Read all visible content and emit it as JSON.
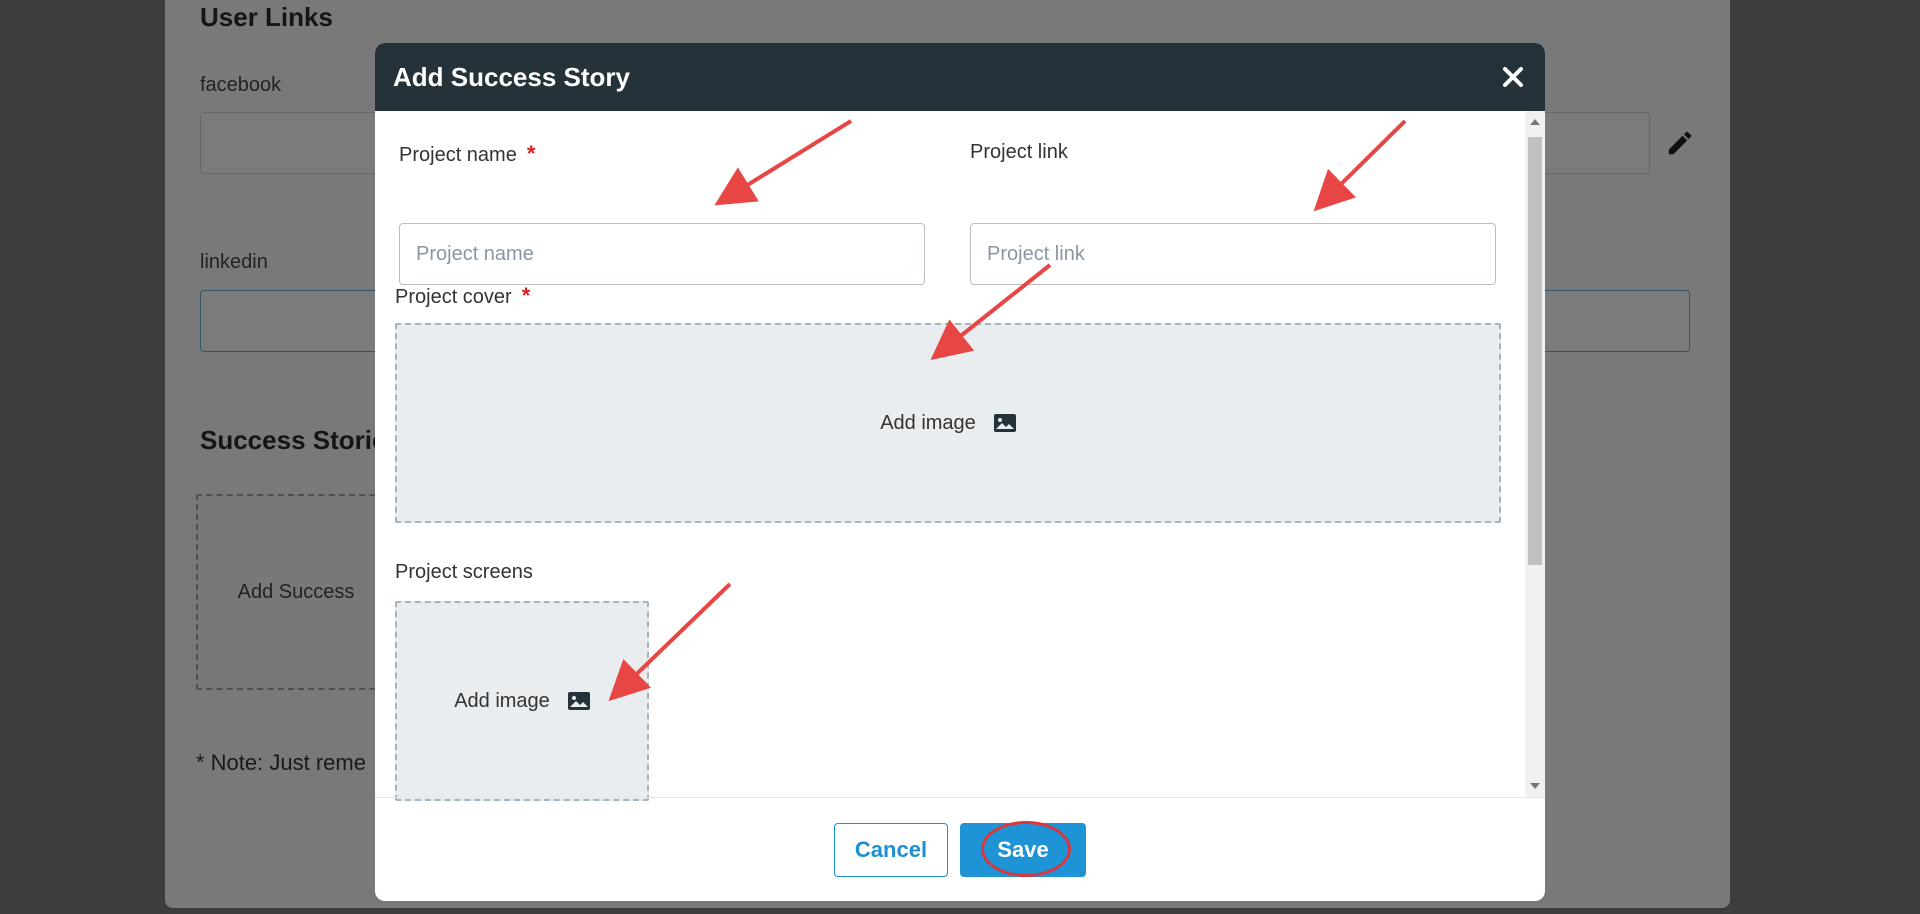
{
  "background": {
    "user_links_heading": "User Links",
    "facebook_label": "facebook",
    "linkedin_label": "linkedin",
    "success_stories_heading": "Success Storie",
    "add_success_label": "Add Success",
    "note_text": "* Note: Just reme"
  },
  "modal": {
    "title": "Add Success Story",
    "close_icon": "close-icon",
    "project_name": {
      "label": "Project name",
      "placeholder": "Project name",
      "required_mark": "*"
    },
    "project_link": {
      "label": "Project link",
      "placeholder": "Project link"
    },
    "project_cover": {
      "label": "Project cover",
      "required_mark": "*",
      "add_image": "Add image"
    },
    "project_screens": {
      "label": "Project screens",
      "add_image": "Add image"
    },
    "footer": {
      "cancel_label": "Cancel",
      "save_label": "Save"
    }
  },
  "colors": {
    "header_bg": "#26323a",
    "primary": "#1e93d6",
    "required": "#e02020",
    "annotation": "#e84545"
  }
}
